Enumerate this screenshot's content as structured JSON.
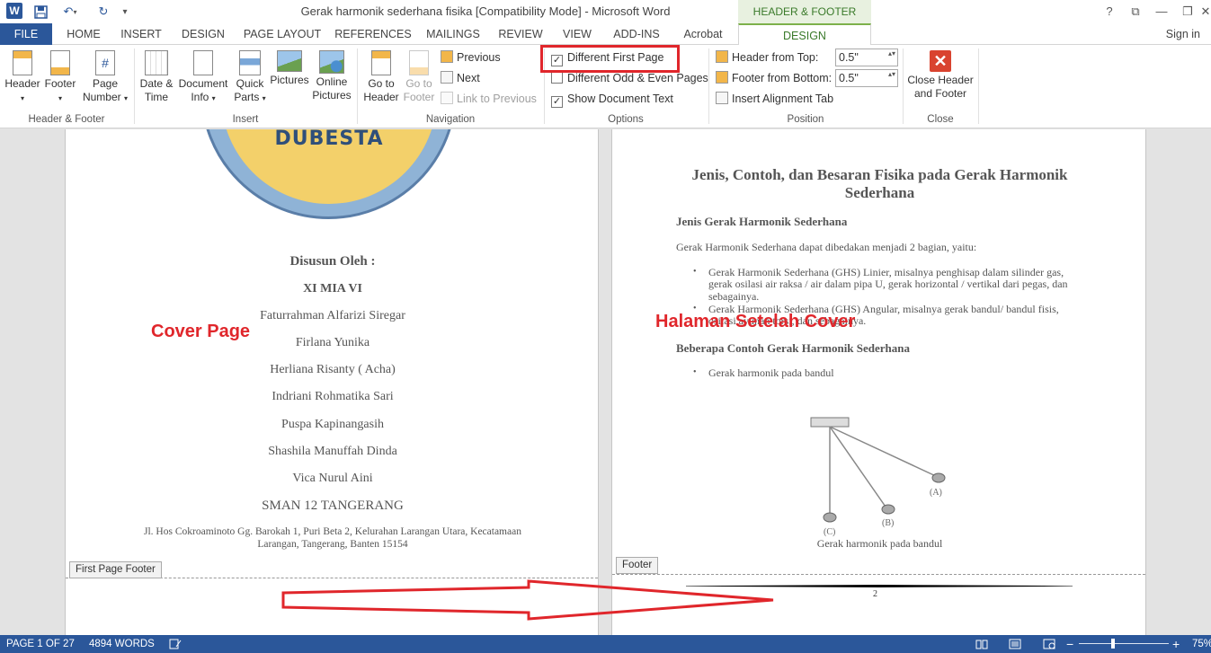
{
  "titlebar": {
    "app_icon": "word-icon",
    "app_icon_letter": "W",
    "title": "Gerak harmonik sederhana fisika [Compatibility Mode] - Microsoft Word",
    "contextual_tool": "HEADER & FOOTER TOOLS",
    "help": "?",
    "minimize": "—",
    "restore": "❐",
    "close": "✕"
  },
  "tabs": {
    "file": "FILE",
    "home": "HOME",
    "insert": "INSERT",
    "design": "DESIGN",
    "page_layout": "PAGE LAYOUT",
    "references": "REFERENCES",
    "mailings": "MAILINGS",
    "review": "REVIEW",
    "view": "VIEW",
    "addins": "ADD-INS",
    "acrobat": "Acrobat",
    "hf_design": "DESIGN",
    "signin": "Sign in"
  },
  "ribbon": {
    "groups": {
      "header_footer": "Header & Footer",
      "insert": "Insert",
      "navigation": "Navigation",
      "options": "Options",
      "position": "Position",
      "close": "Close"
    },
    "header": "Header",
    "footer": "Footer",
    "page_number": [
      "Page",
      "Number"
    ],
    "date_time": [
      "Date &",
      "Time"
    ],
    "document_info": [
      "Document",
      "Info"
    ],
    "quick_parts": [
      "Quick",
      "Parts"
    ],
    "pictures": "Pictures",
    "online_pictures": [
      "Online",
      "Pictures"
    ],
    "go_to_header": [
      "Go to",
      "Header"
    ],
    "go_to_footer": [
      "Go to",
      "Footer"
    ],
    "previous": "Previous",
    "next": "Next",
    "link_to_previous": "Link to Previous",
    "different_first_page": "Different First Page",
    "different_first_page_checked": true,
    "different_odd_even": "Different Odd & Even Pages",
    "different_odd_even_checked": false,
    "show_document_text": "Show Document Text",
    "show_document_text_checked": true,
    "header_from_top": "Header from Top:",
    "header_from_top_value": "0.5\"",
    "footer_from_bottom": "Footer from Bottom:",
    "footer_from_bottom_value": "0.5\"",
    "insert_alignment_tab": "Insert Alignment Tab",
    "close_header_footer": [
      "Close Header",
      "and Footer"
    ]
  },
  "page1": {
    "logo_text": "DUBESTA",
    "disusun": "Disusun Oleh :",
    "kelas": "XI MIA VI",
    "members": [
      "Faturrahman Alfarizi Siregar",
      "Firlana Yunika",
      "Herliana Risanty ( Acha)",
      "Indriani Rohmatika Sari",
      "Puspa Kapinangasih",
      "Shashila Manuffah Dinda",
      "Vica Nurul Aini"
    ],
    "school": "SMAN 12 TANGERANG",
    "address": [
      "Jl. Hos Cokroaminoto Gg. Barokah 1, Puri Beta 2, Kelurahan Larangan Utara, Kecatamaan",
      "Larangan, Tangerang, Banten 15154"
    ],
    "annotation": "Cover Page",
    "footer_tab": "First Page Footer"
  },
  "page2": {
    "title": [
      "Jenis, Contoh, dan Besaran Fisika pada Gerak Harmonik",
      "Sederhana"
    ],
    "heading1": "Jenis Gerak Harmonik Sederhana",
    "intro": "Gerak Harmonik Sederhana dapat dibedakan menjadi 2 bagian, yaitu:",
    "bullet1": [
      "Gerak Harmonik Sederhana (GHS) Linier, misalnya penghisap dalam silinder gas,",
      "gerak osilasi air raksa / air dalam pipa U, gerak horizontal / vertikal dari pegas, dan",
      "sebagainya."
    ],
    "bullet2": [
      "Gerak Harmonik Sederhana (GHS) Angular, misalnya gerak bandul/ bandul fisis,",
      "osilasi ayunan torsi, dan sebagainya."
    ],
    "heading2": "Beberapa Contoh Gerak Harmonik Sederhana",
    "bullet3": "Gerak harmonik pada bandul",
    "label_a": "(A)",
    "label_b": "(B)",
    "label_c": "(C)",
    "caption": "Gerak harmonik pada bandul",
    "annotation": "Halaman Setelah Cover",
    "footer_tab": "Footer",
    "page_number": "2"
  },
  "status": {
    "page": "PAGE 1 OF 27",
    "words": "4894 WORDS",
    "zoom": "75%",
    "zoom_minus": "−",
    "zoom_plus": "+",
    "zoom_fraction": 0.38
  },
  "colors": {
    "word_blue": "#2b579a",
    "annotation_red": "#e0262b",
    "contextual_green": "#3a7a2a"
  }
}
